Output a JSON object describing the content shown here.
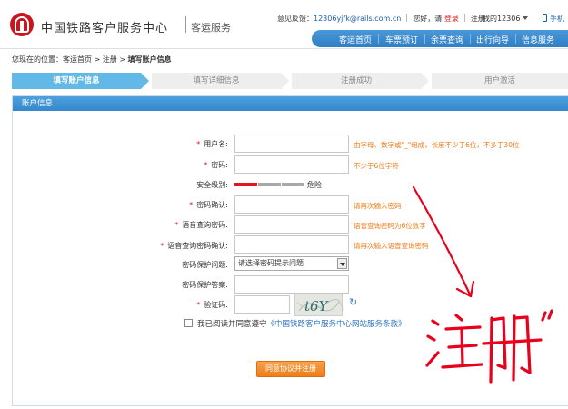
{
  "header": {
    "brand_title": "中国铁路客户服务中心",
    "brand_subtitle": "客运服务",
    "feedback_label": "意见反馈：",
    "feedback_email": "12306yjfk@rails.com.cn",
    "greeting": "您好，请",
    "login_link": "登录",
    "register_link": "注册",
    "my_account": "我的12306",
    "mobile": "手机"
  },
  "nav": {
    "items": [
      {
        "label": "客运首页"
      },
      {
        "label": "车票预订"
      },
      {
        "label": "余票查询"
      },
      {
        "label": "出行向导"
      },
      {
        "label": "信息服务"
      }
    ]
  },
  "breadcrumb": {
    "prefix": "您现在的位置：",
    "home": "客运首页",
    "sep1": ">",
    "register": "注册",
    "sep2": ">",
    "current": "填写账户信息"
  },
  "steps": [
    {
      "label": "填写账户信息",
      "active": true
    },
    {
      "label": "填写详细信息",
      "active": false
    },
    {
      "label": "注册成功",
      "active": false
    },
    {
      "label": "用户激活",
      "active": false
    }
  ],
  "panel": {
    "title": "账户信息"
  },
  "form": {
    "required_mark": "*",
    "username_label": "用户名:",
    "username_hint": "由字母、数字或\"_\"组成，长度不少于6位，不多于30位",
    "password_label": "密码:",
    "password_hint": "不少于6位字符",
    "security_label": "安全级别:",
    "security_level": "危险",
    "security_fraction": 0.33,
    "confirm_label": "密码确认:",
    "confirm_hint": "请再次输入密码",
    "voice_label": "语音查询密码:",
    "voice_hint": "语音查询密码为6位数字",
    "voice_confirm_label": "语音查询密码确认:",
    "voice_confirm_hint": "请再次输入语音查询密码",
    "question_label": "密码保护问题:",
    "question_selected": "请选择密码提示问题",
    "answer_label": "密码保护答案:",
    "captcha_label": "验证码:",
    "captcha_text": "t6Y",
    "refresh_icon": "↻",
    "agree_prefix": "我已阅读并同意遵守",
    "agree_link": "《中国铁路客户服务中心网站服务条款》",
    "submit_label": "同意协议并注册"
  },
  "annotation": {
    "text": "注册\""
  },
  "colors": {
    "nav_blue": "#3a8bd0",
    "step_active": "#62b8e6",
    "hint_orange": "#f07a14",
    "required_red": "#e01b1b",
    "submit_orange": "#f08a26",
    "annotation_red": "#e8001c"
  }
}
